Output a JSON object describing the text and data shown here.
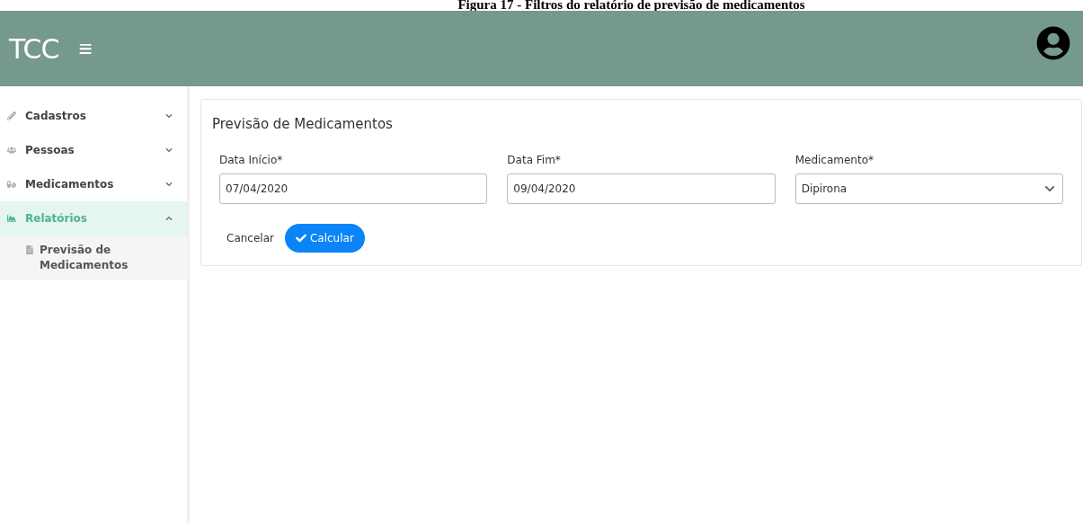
{
  "caption": "Figura 17 - Filtros do relatório de previsão de medicamentos",
  "header": {
    "logo": "TCC",
    "menu_icon": "≡"
  },
  "sidebar": {
    "items": [
      {
        "label": "Cadastros",
        "expanded": false,
        "selected": false
      },
      {
        "label": "Pessoas",
        "expanded": false,
        "selected": false
      },
      {
        "label": "Medicamentos",
        "expanded": false,
        "selected": false
      },
      {
        "label": "Relatórios",
        "expanded": true,
        "selected": true,
        "children": [
          {
            "label": "Previsão de Medicamentos"
          }
        ]
      }
    ]
  },
  "form": {
    "title": "Previsão de Medicamentos",
    "fields": [
      {
        "kind": "text",
        "label": "Data Início*",
        "value": "07/04/2020"
      },
      {
        "kind": "text",
        "label": "Data Fim*",
        "value": "09/04/2020"
      },
      {
        "kind": "select",
        "label": "Medicamento*",
        "value": "Dipirona"
      }
    ],
    "buttons": [
      {
        "kind": "link",
        "label": "Cancelar"
      },
      {
        "kind": "primary",
        "label": "Calcular"
      }
    ]
  }
}
